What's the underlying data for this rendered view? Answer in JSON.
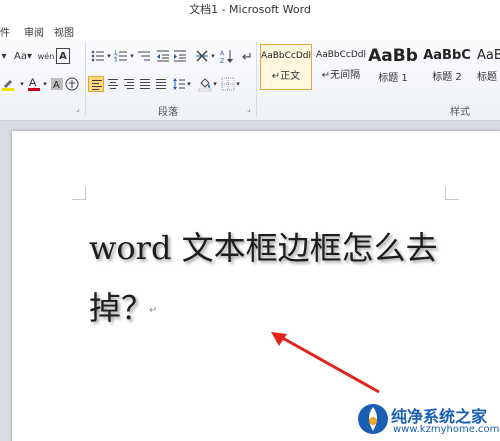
{
  "window": {
    "title": "文档1 - Microsoft Word"
  },
  "menu": {
    "items": [
      "件",
      "审阅",
      "视图"
    ]
  },
  "ribbon": {
    "font_group": {
      "font_size_button": "Aa▾",
      "phonetic_button": "wén",
      "char_border_button": "A"
    },
    "paragraph_group": {
      "label": "段落"
    },
    "styles_group": {
      "label": "样式",
      "styles": [
        {
          "sample": "AaBbCcDdl",
          "name": "↵正文",
          "selected": true
        },
        {
          "sample": "AaBbCcDdl",
          "name": "↵无间隔",
          "selected": false
        },
        {
          "sample": "AaBb",
          "name": "标题 1",
          "selected": false
        },
        {
          "sample": "AaBbC",
          "name": "标题 2",
          "selected": false
        },
        {
          "sample": "AaBbC",
          "name": "标题",
          "selected": false
        }
      ]
    }
  },
  "document": {
    "line1": "word 文本框边框怎么去",
    "line2": "掉？"
  },
  "watermark": {
    "title": "纯净系统之家",
    "url": "www.kzmyhome.com"
  },
  "colors": {
    "ribbon_bg": "#eef1f5",
    "highlight_yellow": "#fbd983",
    "font_color_red": "#d0021b",
    "arrow_red": "#e2231a",
    "watermark_blue": "#1a5fb4"
  }
}
